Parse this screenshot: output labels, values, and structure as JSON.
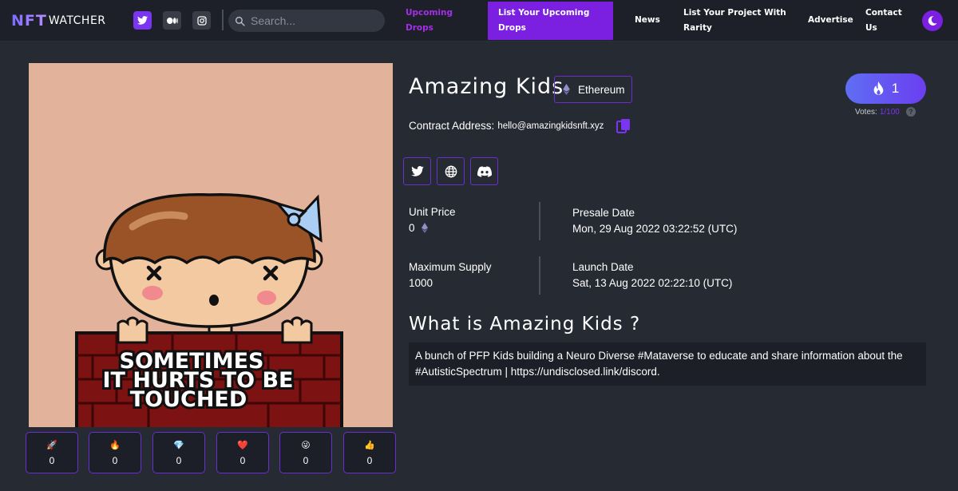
{
  "nav": {
    "logo_main": "NFT",
    "logo_sub": "WATCHER",
    "social": [
      "twitter-icon",
      "medium-icon",
      "instagram-icon"
    ],
    "search_placeholder": "Search...",
    "links": {
      "upcoming": "Upcoming Drops",
      "list_upcoming": "List Your Upcoming Drops",
      "news": "News",
      "rarity": "List Your Project With Rarity",
      "advertise": "Advertise",
      "contact": "Contact Us"
    },
    "theme_icon": "moon-icon",
    "colors": {
      "accent": "#7b20e0",
      "upcoming": "#a52ee8"
    }
  },
  "nft": {
    "image_caption": "SOMETIMES IT HURTS TO BE TOUCHED",
    "image_caption_lines": [
      "SOMETIMES",
      "IT HURTS TO BE",
      "TOUCHED"
    ],
    "name": "Amazing Kids",
    "chain": "Ethereum",
    "contract_label": "Contract Address:",
    "contract_value": "hello@amazingkidsnft.xyz",
    "links": [
      "twitter-icon",
      "globe-icon",
      "discord-icon"
    ],
    "unit_price_label": "Unit Price",
    "unit_price_value": "0",
    "presale_label": "Presale Date",
    "presale_value": "Mon, 29 Aug 2022 03:22:52 (UTC)",
    "max_supply_label": "Maximum Supply",
    "max_supply_value": "1000",
    "launch_label": "Launch Date",
    "launch_value": "Sat, 13 Aug 2022 02:22:10 (UTC)",
    "section_title": "What is Amazing Kids ?",
    "description": "A bunch of PFP Kids building a Neuro Diverse #Mataverse to educate and share information about the #AutisticSpectrum | https://undisclosed.link/discord."
  },
  "votes": {
    "count": "1",
    "label": "Votes:",
    "value": "1/100",
    "help": "?"
  },
  "reactions": [
    {
      "emoji": "🚀",
      "count": "0"
    },
    {
      "emoji": "🔥",
      "count": "0"
    },
    {
      "emoji": "💎",
      "count": "0"
    },
    {
      "emoji": "❤️",
      "count": "0"
    },
    {
      "emoji": "😜",
      "count": "0"
    },
    {
      "emoji": "👍",
      "count": "0"
    }
  ]
}
